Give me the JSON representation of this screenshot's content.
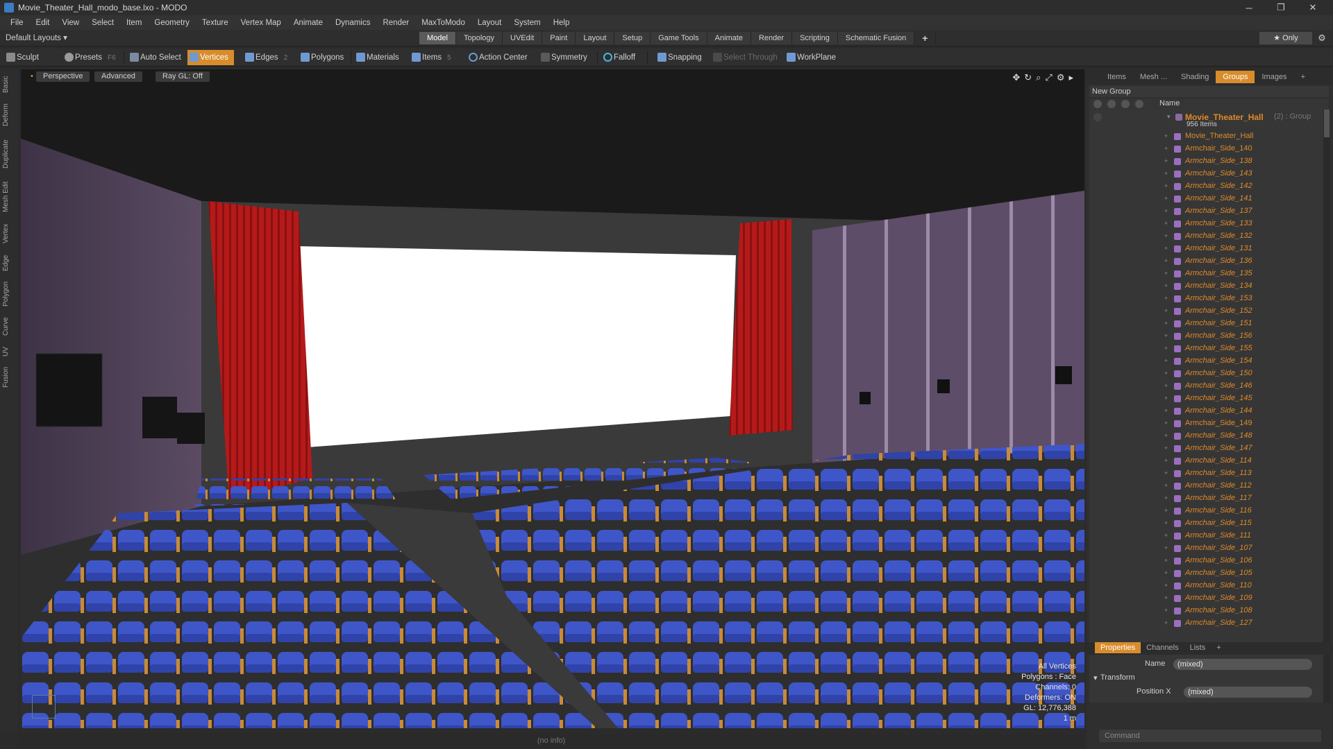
{
  "window": {
    "title": "Movie_Theater_Hall_modo_base.lxo - MODO",
    "controls": [
      "─",
      "❐",
      "✕"
    ]
  },
  "menu": [
    "File",
    "Edit",
    "View",
    "Select",
    "Item",
    "Geometry",
    "Texture",
    "Vertex Map",
    "Animate",
    "Dynamics",
    "Render",
    "MaxToModo",
    "Layout",
    "System",
    "Help"
  ],
  "layout_selector": "Default Layouts ▾",
  "layout_tabs": [
    "Model",
    "Topology",
    "UVEdit",
    "Paint",
    "Layout",
    "Setup",
    "Game Tools",
    "Animate",
    "Render",
    "Scripting",
    "Schematic Fusion",
    "+"
  ],
  "only_button": "★  Only",
  "toolbar": {
    "sculpt": "Sculpt",
    "presets": "Presets",
    "presets_key": "F6",
    "auto_select": "Auto Select",
    "vertices": "Vertices",
    "edges": "Edges",
    "edges_count": "2",
    "polygons": "Polygons",
    "materials": "Materials",
    "items": "Items",
    "items_count": "5",
    "action_center": "Action Center",
    "symmetry": "Symmetry",
    "falloff": "Falloff",
    "snapping": "Snapping",
    "select_through": "Select Through",
    "workplane": "WorkPlane"
  },
  "left_tabs": [
    "Basic",
    "Deform",
    "Duplicate",
    "Mesh Edit",
    "Vertex",
    "Edge",
    "Polygon",
    "Curve",
    "UV",
    "Fusion"
  ],
  "viewport": {
    "view_mode": "Perspective",
    "advanced": "Advanced",
    "ray_gl": "Ray GL: Off",
    "info": {
      "line1": "All Vertices",
      "line2": "Polygons : Face",
      "line3": "Channels: 0",
      "line4": "Deformers: ON",
      "line5": "GL: 12,776,388",
      "line6": "1 m"
    }
  },
  "status_text": "(no info)",
  "right_panel": {
    "tabs": [
      "Items",
      "Mesh ...",
      "Shading",
      "Groups",
      "Images",
      "+"
    ],
    "new_group": "New Group",
    "name_header": "Name",
    "group_name": "Movie_Theater_Hall",
    "group_suffix": "(2) : Group",
    "group_count": "956 Items",
    "items": [
      {
        "name": "Movie_Theater_Hall",
        "style": "plain"
      },
      {
        "name": "Armchair_Side_140",
        "style": "plain"
      },
      {
        "name": "Armchair_Side_138",
        "style": "italic"
      },
      {
        "name": "Armchair_Side_143",
        "style": "italic"
      },
      {
        "name": "Armchair_Side_142",
        "style": "italic"
      },
      {
        "name": "Armchair_Side_141",
        "style": "italic"
      },
      {
        "name": "Armchair_Side_137",
        "style": "italic"
      },
      {
        "name": "Armchair_Side_133",
        "style": "italic"
      },
      {
        "name": "Armchair_Side_132",
        "style": "italic"
      },
      {
        "name": "Armchair_Side_131",
        "style": "italic"
      },
      {
        "name": "Armchair_Side_136",
        "style": "italic"
      },
      {
        "name": "Armchair_Side_135",
        "style": "italic"
      },
      {
        "name": "Armchair_Side_134",
        "style": "italic"
      },
      {
        "name": "Armchair_Side_153",
        "style": "italic"
      },
      {
        "name": "Armchair_Side_152",
        "style": "italic"
      },
      {
        "name": "Armchair_Side_151",
        "style": "italic"
      },
      {
        "name": "Armchair_Side_156",
        "style": "italic"
      },
      {
        "name": "Armchair_Side_155",
        "style": "italic"
      },
      {
        "name": "Armchair_Side_154",
        "style": "italic"
      },
      {
        "name": "Armchair_Side_150",
        "style": "italic"
      },
      {
        "name": "Armchair_Side_146",
        "style": "italic"
      },
      {
        "name": "Armchair_Side_145",
        "style": "italic"
      },
      {
        "name": "Armchair_Side_144",
        "style": "italic"
      },
      {
        "name": "Armchair_Side_149",
        "style": "plain"
      },
      {
        "name": "Armchair_Side_148",
        "style": "italic"
      },
      {
        "name": "Armchair_Side_147",
        "style": "italic"
      },
      {
        "name": "Armchair_Side_114",
        "style": "italic"
      },
      {
        "name": "Armchair_Side_113",
        "style": "italic"
      },
      {
        "name": "Armchair_Side_112",
        "style": "italic"
      },
      {
        "name": "Armchair_Side_117",
        "style": "italic"
      },
      {
        "name": "Armchair_Side_116",
        "style": "italic"
      },
      {
        "name": "Armchair_Side_115",
        "style": "italic"
      },
      {
        "name": "Armchair_Side_111",
        "style": "italic"
      },
      {
        "name": "Armchair_Side_107",
        "style": "italic"
      },
      {
        "name": "Armchair_Side_106",
        "style": "italic"
      },
      {
        "name": "Armchair_Side_105",
        "style": "italic"
      },
      {
        "name": "Armchair_Side_110",
        "style": "italic"
      },
      {
        "name": "Armchair_Side_109",
        "style": "italic"
      },
      {
        "name": "Armchair_Side_108",
        "style": "italic"
      },
      {
        "name": "Armchair_Side_127",
        "style": "italic"
      }
    ],
    "props_tabs": [
      "Properties",
      "Channels",
      "Lists",
      "+"
    ],
    "name_label": "Name",
    "name_value": "(mixed)",
    "transform_label": "Transform",
    "position_x_label": "Position X",
    "position_x_value": "(mixed)",
    "command_placeholder": "Command"
  },
  "colors": {
    "accent": "#d98c2b",
    "item_text": "#e08a2a",
    "mesh_icon": "#9b6fc0",
    "seat_blue": "#3c4fbf",
    "curtain_red": "#b51a1a"
  }
}
